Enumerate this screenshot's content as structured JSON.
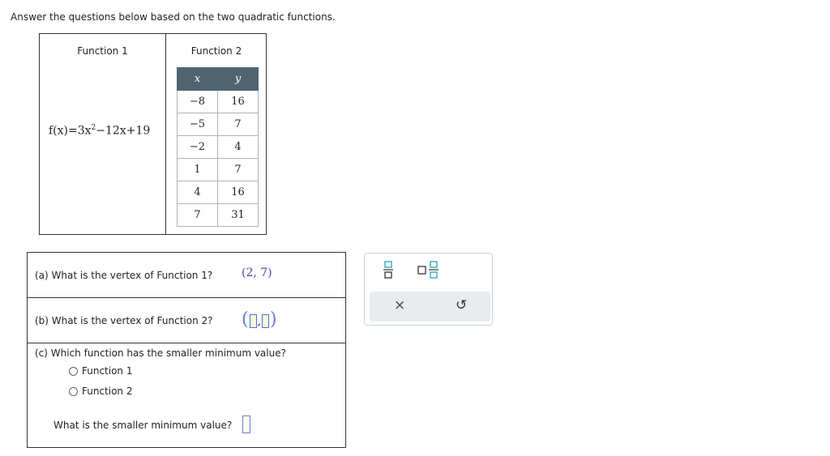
{
  "instructions": "Answer the questions below based on the two quadratic functions.",
  "function1": {
    "header": "Function 1",
    "expr_lhs": "f(x)=3x",
    "expr_exp": "2",
    "expr_rhs": "−12x+19"
  },
  "function2": {
    "header": "Function 2",
    "columns": [
      "x",
      "y"
    ],
    "rows": [
      [
        "−8",
        "16"
      ],
      [
        "−5",
        "7"
      ],
      [
        "−2",
        "4"
      ],
      [
        "1",
        "7"
      ],
      [
        "4",
        "16"
      ],
      [
        "7",
        "31"
      ]
    ]
  },
  "questions": {
    "a": {
      "prompt": "(a) What is the vertex of Function 1?",
      "answer": "(2, 7)"
    },
    "b": {
      "prompt": "(b) What is the vertex of Function 2?",
      "open": "(",
      "comma": ",",
      "close": ")"
    },
    "c": {
      "prompt": "(c) Which function has the smaller minimum value?",
      "options": [
        "Function 1",
        "Function 2"
      ],
      "followup": "What is the smaller minimum value?"
    }
  },
  "palette": {
    "tools": [
      "fraction-icon",
      "mixed-number-icon",
      "clear-icon",
      "undo-icon"
    ],
    "clear_glyph": "×",
    "undo_glyph": "↺",
    "accent": "#27a3b4"
  }
}
